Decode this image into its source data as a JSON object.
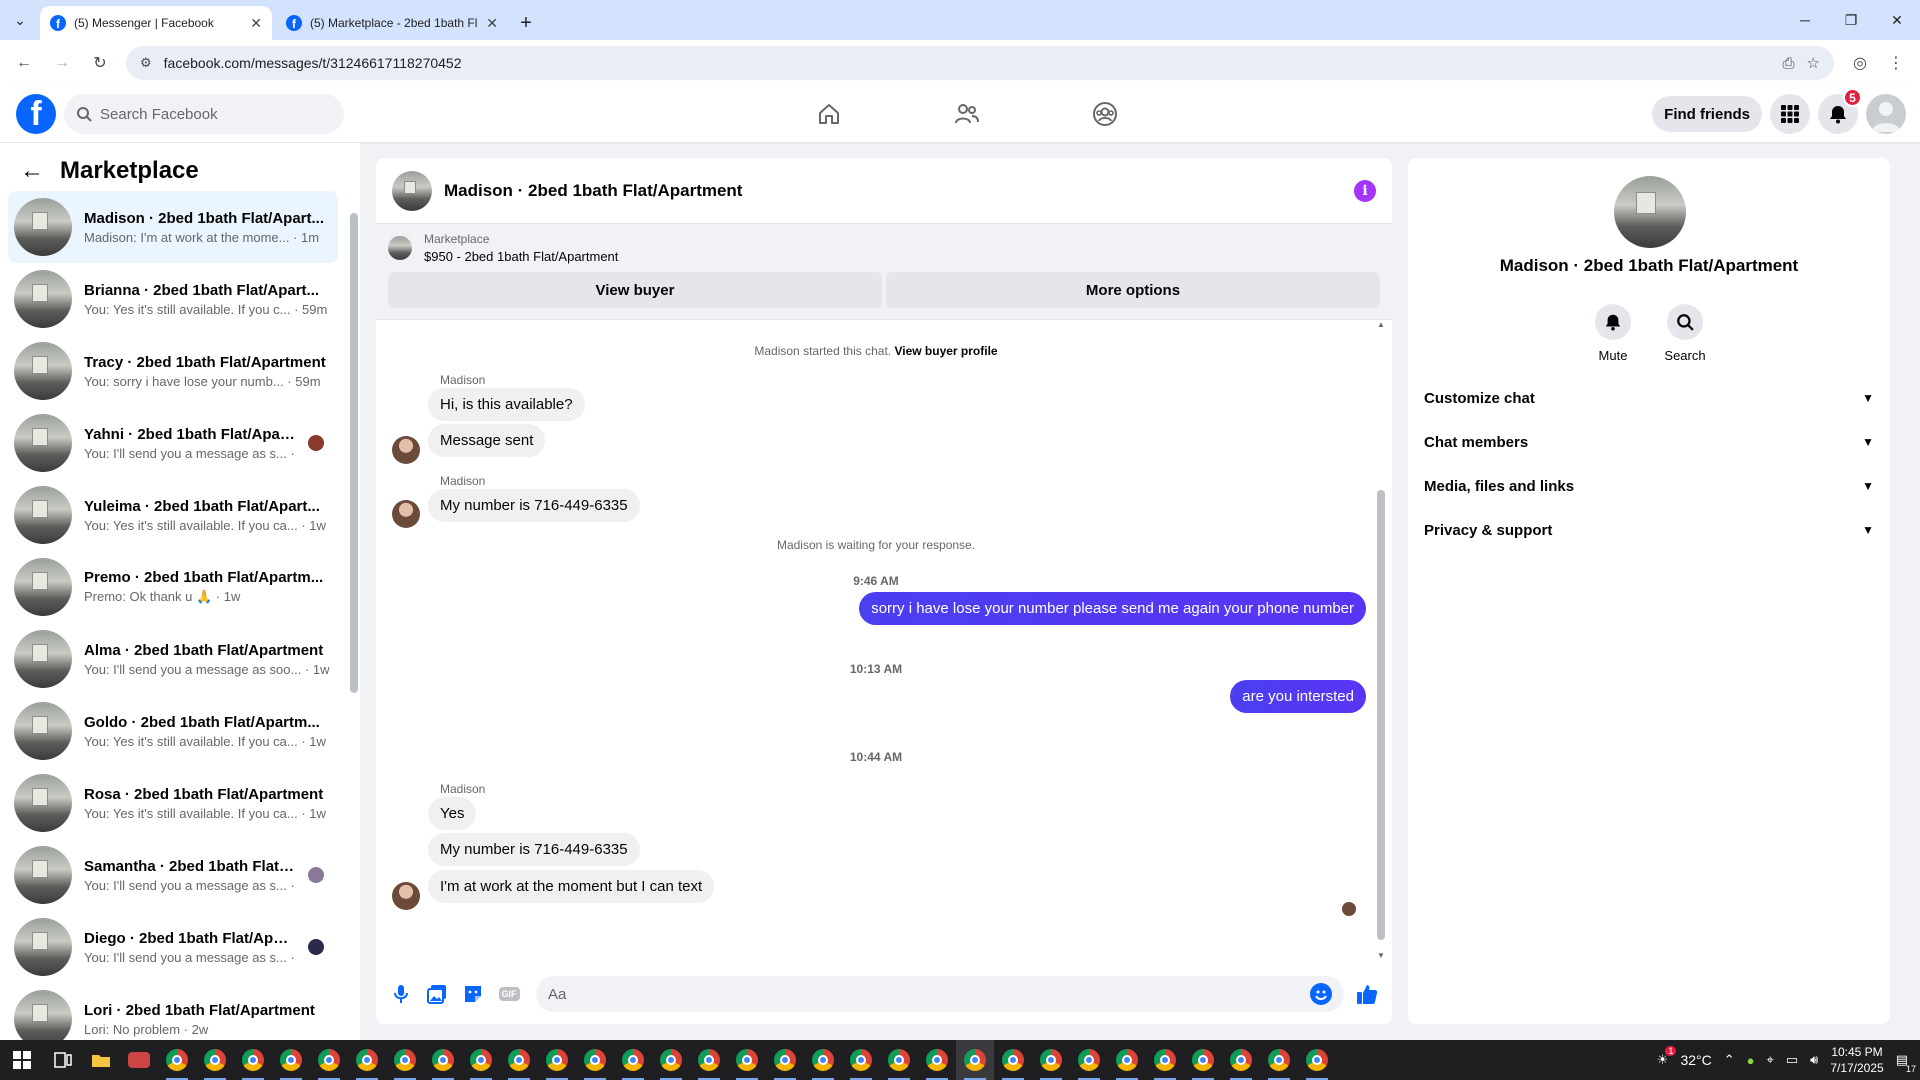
{
  "browser": {
    "tabs": [
      {
        "title": "(5) Messenger | Facebook",
        "active": true
      },
      {
        "title": "(5) Marketplace - 2bed 1bath Fl",
        "active": false
      }
    ],
    "url": "facebook.com/messages/t/31246617118270452"
  },
  "fbnav": {
    "search_placeholder": "Search Facebook",
    "find_friends": "Find friends",
    "notification_count": "5"
  },
  "sidebar": {
    "title": "Marketplace",
    "conversations": [
      {
        "name": "Madison · 2bed 1bath Flat/Apart...",
        "snippet": "Madison: I'm at work at the mome... · 1m",
        "selected": true
      },
      {
        "name": "Brianna · 2bed 1bath Flat/Apart...",
        "snippet": "You: Yes it's still available. If you c... · 59m"
      },
      {
        "name": "Tracy · 2bed 1bath Flat/Apartment",
        "snippet": "You: sorry i have lose your numb... · 59m"
      },
      {
        "name": "Yahni · 2bed 1bath Flat/Apart...",
        "snippet": "You: I'll send you a message as s... · 1w"
      },
      {
        "name": "Yuleima · 2bed 1bath Flat/Apart...",
        "snippet": "You: Yes it's still available. If you ca... · 1w"
      },
      {
        "name": "Premo · 2bed 1bath Flat/Apartm...",
        "snippet": "Premo: Ok thank u 🙏 · 1w"
      },
      {
        "name": "Alma · 2bed 1bath Flat/Apartment",
        "snippet": "You: I'll send you a message as soo... · 1w"
      },
      {
        "name": "Goldo · 2bed 1bath Flat/Apartm...",
        "snippet": "You: Yes it's still available. If you ca... · 1w"
      },
      {
        "name": "Rosa · 2bed 1bath Flat/Apartment",
        "snippet": "You: Yes it's still available. If you ca... · 1w"
      },
      {
        "name": "Samantha · 2bed 1bath Flat/A...",
        "snippet": "You: I'll send you a message as s... · 1w"
      },
      {
        "name": "Diego · 2bed 1bath Flat/Apart...",
        "snippet": "You: I'll send you a message as s... · 2w"
      },
      {
        "name": "Lori · 2bed 1bath Flat/Apartment",
        "snippet": "Lori: No problem · 2w"
      }
    ]
  },
  "chat": {
    "title": "Madison · 2bed 1bath Flat/Apartment",
    "listing_source": "Marketplace",
    "listing_title": "$950 - 2bed 1bath Flat/Apartment",
    "view_buyer": "View buyer",
    "more_options": "More options",
    "started_note": "Madison started this chat.",
    "view_buyer_profile": "View buyer profile",
    "sender": "Madison",
    "msg1": "Hi, is this available?",
    "msg2": "Message sent",
    "msg3": "My number is 716-449-6335",
    "waiting_note": "Madison is waiting for your response.",
    "time1": "9:46 AM",
    "out1": "sorry i have lose your number please send me again your phone number",
    "time2": "10:13 AM",
    "out2": "are you intersted",
    "time3": "10:44 AM",
    "msg4": "Yes",
    "msg5": "My number is 716-449-6335",
    "msg6": "I'm at work at the moment but I can text",
    "composer_placeholder": "Aa"
  },
  "details": {
    "name": "Madison · 2bed 1bath Flat/Apartment",
    "mute": "Mute",
    "search": "Search",
    "sections": [
      "Customize chat",
      "Chat members",
      "Media, files and links",
      "Privacy & support"
    ]
  },
  "taskbar": {
    "weather_badge": "1",
    "temperature": "32°C",
    "time": "10:45 PM",
    "date": "7/17/2025",
    "notif_count": "17"
  }
}
